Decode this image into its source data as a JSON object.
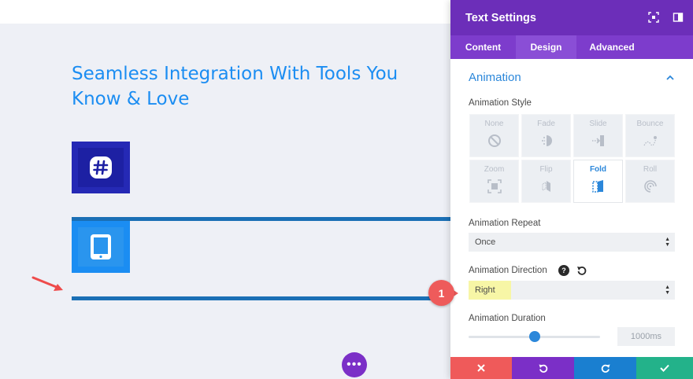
{
  "canvas": {
    "headline": "Seamless Integration With Tools You Know & Love",
    "more_button_label": "•••"
  },
  "panel": {
    "title": "Text Settings",
    "tabs": [
      {
        "label": "Content",
        "active": false
      },
      {
        "label": "Design",
        "active": true
      },
      {
        "label": "Advanced",
        "active": false
      }
    ],
    "section_title": "Animation",
    "animation_style_label": "Animation Style",
    "styles": [
      {
        "label": "None",
        "icon": "none-icon",
        "active": false
      },
      {
        "label": "Fade",
        "icon": "fade-icon",
        "active": false
      },
      {
        "label": "Slide",
        "icon": "slide-icon",
        "active": false
      },
      {
        "label": "Bounce",
        "icon": "bounce-icon",
        "active": false
      },
      {
        "label": "Zoom",
        "icon": "zoom-icon",
        "active": false
      },
      {
        "label": "Flip",
        "icon": "flip-icon",
        "active": false
      },
      {
        "label": "Fold",
        "icon": "fold-icon",
        "active": true
      },
      {
        "label": "Roll",
        "icon": "roll-icon",
        "active": false
      }
    ],
    "repeat_label": "Animation Repeat",
    "repeat_value": "Once",
    "direction_label": "Animation Direction",
    "direction_help": "?",
    "direction_value": "Right",
    "duration_label": "Animation Duration",
    "duration_value": "1000ms",
    "duration_slider_fraction": 0.5
  },
  "callout": {
    "number": "1"
  },
  "colors": {
    "panel_header": "#6c2eb9",
    "tab_bar": "#7d3ccc",
    "accent_blue": "#2b87da",
    "cancel": "#ef5a5a",
    "undo": "#7b2fc7",
    "redo": "#1a7fd0",
    "save": "#23b28a"
  }
}
